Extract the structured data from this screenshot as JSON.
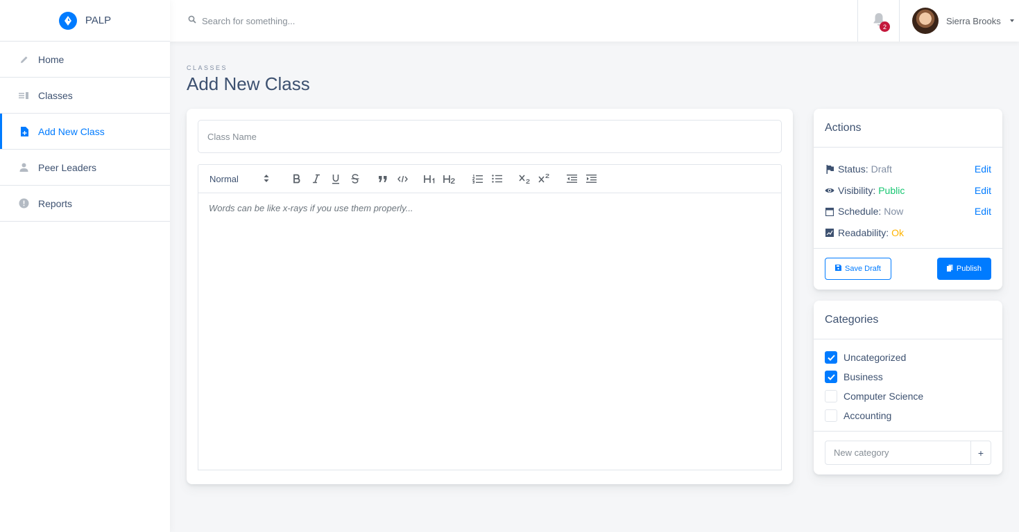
{
  "brand": {
    "name": "PALP",
    "icon": "compass-icon"
  },
  "sidebar": {
    "items": [
      {
        "label": "Home",
        "icon": "pencil-icon",
        "active": false
      },
      {
        "label": "Classes",
        "icon": "list-icon",
        "active": false
      },
      {
        "label": "Add New Class",
        "icon": "note-add-icon",
        "active": true
      },
      {
        "label": "Peer Leaders",
        "icon": "person-icon",
        "active": false
      },
      {
        "label": "Reports",
        "icon": "error-icon",
        "active": false
      }
    ]
  },
  "header": {
    "search_placeholder": "Search for something...",
    "notifications_count": "2",
    "user_name": "Sierra Brooks"
  },
  "page": {
    "subtitle": "CLASSES",
    "title": "Add New Class"
  },
  "editor": {
    "class_name_placeholder": "Class Name",
    "format_select": "Normal",
    "body_placeholder": "Words can be like x-rays if you use them properly..."
  },
  "actions": {
    "title": "Actions",
    "rows": [
      {
        "label": "Status:",
        "value": "Draft",
        "edit": "Edit",
        "icon": "flag-icon"
      },
      {
        "label": "Visibility:",
        "value": "Public",
        "edit": "Edit",
        "icon": "eye-icon"
      },
      {
        "label": "Schedule:",
        "value": "Now",
        "edit": "Edit",
        "icon": "calendar-icon"
      },
      {
        "label": "Readability:",
        "value": "Ok",
        "icon": "score-icon"
      }
    ],
    "save_draft": "Save Draft",
    "publish": "Publish"
  },
  "categories": {
    "title": "Categories",
    "items": [
      {
        "label": "Uncategorized",
        "checked": true
      },
      {
        "label": "Business",
        "checked": true
      },
      {
        "label": "Computer Science",
        "checked": false
      },
      {
        "label": "Accounting",
        "checked": false
      }
    ],
    "new_placeholder": "New category",
    "add_label": "+"
  },
  "colors": {
    "accent": "#007bff",
    "success": "#17c671",
    "warning": "#ffb400",
    "danger": "#c4183c",
    "text": "#3d5170"
  }
}
